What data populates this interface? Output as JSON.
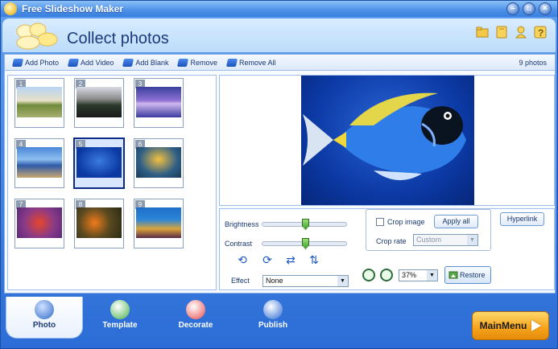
{
  "app": {
    "title": "Free Slideshow Maker",
    "window_buttons": [
      "minimize",
      "maximize",
      "close"
    ]
  },
  "header": {
    "title": "Collect photos",
    "icons": [
      "folder-icon",
      "book-icon",
      "user-icon",
      "help-icon"
    ]
  },
  "toolbar": {
    "items": [
      {
        "label": "Add Photo",
        "icon": "add-photo-icon"
      },
      {
        "label": "Add Video",
        "icon": "add-video-icon"
      },
      {
        "label": "Add Blank",
        "icon": "add-blank-icon"
      },
      {
        "label": "Remove",
        "icon": "remove-icon"
      },
      {
        "label": "Remove All",
        "icon": "remove-all-icon"
      }
    ],
    "count": "9 photos"
  },
  "thumbnails": [
    {
      "num": "1",
      "selected": false
    },
    {
      "num": "2",
      "selected": false
    },
    {
      "num": "3",
      "selected": false
    },
    {
      "num": "4",
      "selected": false
    },
    {
      "num": "5",
      "selected": true
    },
    {
      "num": "6",
      "selected": false
    },
    {
      "num": "7",
      "selected": false
    },
    {
      "num": "8",
      "selected": false
    },
    {
      "num": "9",
      "selected": false
    }
  ],
  "controls": {
    "brightness_label": "Brightness",
    "contrast_label": "Contrast",
    "brightness_value": 0.5,
    "contrast_value": 0.5,
    "effect_label": "Effect",
    "effect_value": "None",
    "crop_image_label": "Crop image",
    "crop_image_checked": false,
    "apply_all": "Apply all",
    "crop_rate_label": "Crop rate",
    "crop_rate_value": "Custom",
    "hyperlink": "Hyperlink",
    "zoom_value": "37%",
    "restore": "Restore"
  },
  "tabs": [
    {
      "label": "Photo",
      "active": true
    },
    {
      "label": "Template",
      "active": false
    },
    {
      "label": "Decorate",
      "active": false
    },
    {
      "label": "Publish",
      "active": false
    }
  ],
  "main_menu": "MainMenu",
  "colors": {
    "accent": "#2b6cd6",
    "header_bg": "#bcdcfa",
    "main_menu": "#f5a21a"
  }
}
